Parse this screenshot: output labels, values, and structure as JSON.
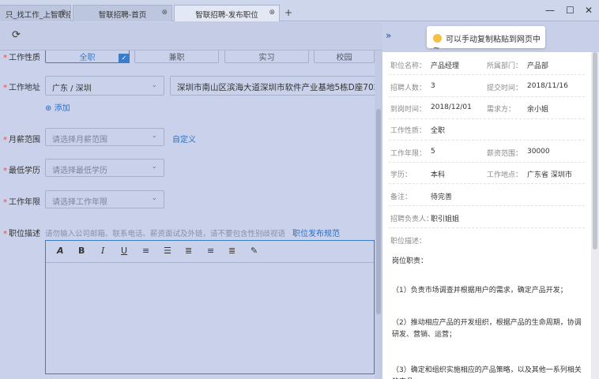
{
  "tabs": [
    {
      "label": "只_找工作_上智联招...",
      "close": "⊗"
    },
    {
      "label": "智联招聘-首页",
      "close": "⊗"
    },
    {
      "label": "智联招聘-发布职位",
      "close": "⊗"
    }
  ],
  "window": {
    "new_tab": "+",
    "minimize": "—",
    "maximize": "☐",
    "close": "✕"
  },
  "toolbar": {
    "reload_icon": "⟳"
  },
  "form": {
    "job_nature": {
      "label": "工作性质",
      "options": [
        "全职",
        "兼职",
        "实习",
        "校园"
      ],
      "selected": "全职"
    },
    "location": {
      "label": "工作地址",
      "city": "广东 / 深圳",
      "address": "深圳市南山区滨海大道深圳市软件产业基地5栋D座702",
      "add_link": "添加"
    },
    "salary": {
      "label": "月薪范围",
      "placeholder": "请选择月薪范围",
      "custom_link": "自定义"
    },
    "education": {
      "label": "最低学历",
      "placeholder": "请选择最低学历"
    },
    "experience": {
      "label": "工作年限",
      "placeholder": "请选择工作年限"
    },
    "description": {
      "label": "职位描述",
      "hint": "请勿输入公司邮箱、联系电话、薪资面试及外链，请不要包含性别歧视语",
      "rule_link": "职位发布规范"
    }
  },
  "editor_tools": [
    "A",
    "B",
    "I",
    "U",
    "≡",
    "☰",
    "≣",
    "≡",
    "≣",
    "✎"
  ],
  "toast": {
    "text": "可以手动复制粘贴到网页中~"
  },
  "panel": {
    "rows": [
      {
        "k1": "职位名称：",
        "v1": "产品经理",
        "k2": "所属部门：",
        "v2": "产品部"
      },
      {
        "k1": "招聘人数：",
        "v1": "3",
        "k2": "提交时间：",
        "v2": "2018/11/16"
      },
      {
        "k1": "到岗时间：",
        "v1": "2018/12/01",
        "k2": "需求方：",
        "v2": "余小姐"
      },
      {
        "k1": "工作性质：",
        "v1": "全职",
        "k2": "",
        "v2": ""
      },
      {
        "k1": "工作年限：",
        "v1": "5",
        "k2": "薪资范围：",
        "v2": "30000"
      },
      {
        "k1": "学历：",
        "v1": "本科",
        "k2": "工作地点：",
        "v2": "广东省 深圳市"
      },
      {
        "k1": "备注：",
        "v1": "待完善",
        "k2": "",
        "v2": ""
      },
      {
        "k1": "招聘负责人：",
        "v1": "职引姐姐",
        "k2": "",
        "v2": ""
      }
    ],
    "desc_label": "职位描述：",
    "duty_label": "岗位职责：",
    "paragraphs": [
      "（1）负责市场调查并根据用户的需求，确定产品开发；",
      "（2）推动相应产品的开发组织，根据产品的生命周期，协调研发、营销、运营；",
      "（3）确定和组织实施相应的产品策略，以及其他一系列相关的产品"
    ]
  }
}
